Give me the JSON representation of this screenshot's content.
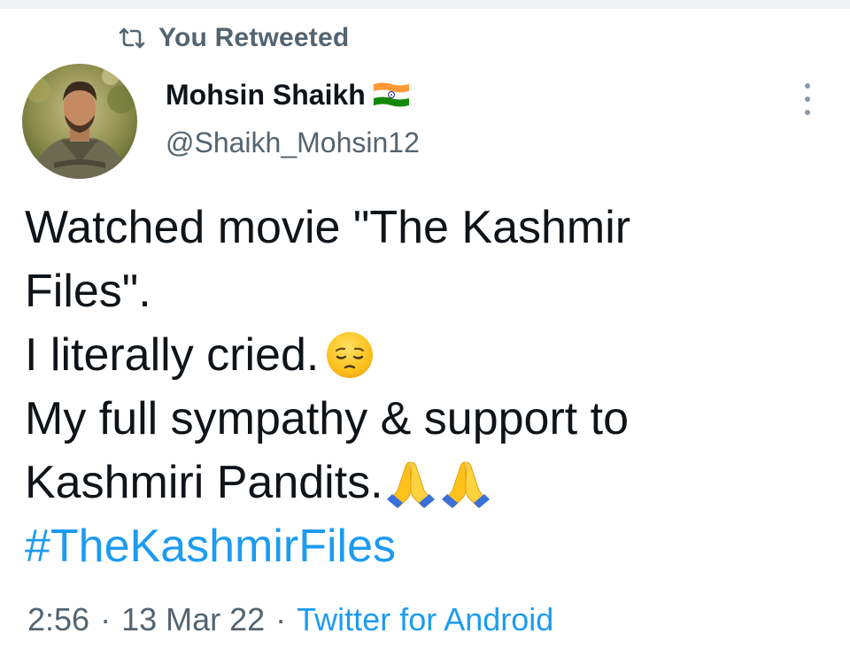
{
  "retweet": {
    "label": "You Retweeted",
    "icon": "retweet-icon"
  },
  "author": {
    "display_name": "Mohsin Shaikh",
    "handle": "@Shaikh_Mohsin12",
    "flag_icon": "india-flag-icon",
    "avatar_icon": "avatar-photo"
  },
  "more_icon": "more-options-icon",
  "tweet": {
    "lines": [
      "Watched movie \"The Kashmir",
      "Files\".",
      "I literally cried.",
      "My full sympathy & support to",
      "Kashmiri Pandits."
    ],
    "hashtag": "#TheKashmirFiles",
    "emoji_face": "pensive-face-emoji",
    "emoji_pray": "folded-hands-emoji"
  },
  "meta": {
    "time": "2:56",
    "date": "13 Mar 22",
    "separator": "·",
    "source": "Twitter for Android"
  },
  "colors": {
    "link": "#1d9bf0",
    "secondary_text": "#536471",
    "primary_text": "#0f1419"
  }
}
